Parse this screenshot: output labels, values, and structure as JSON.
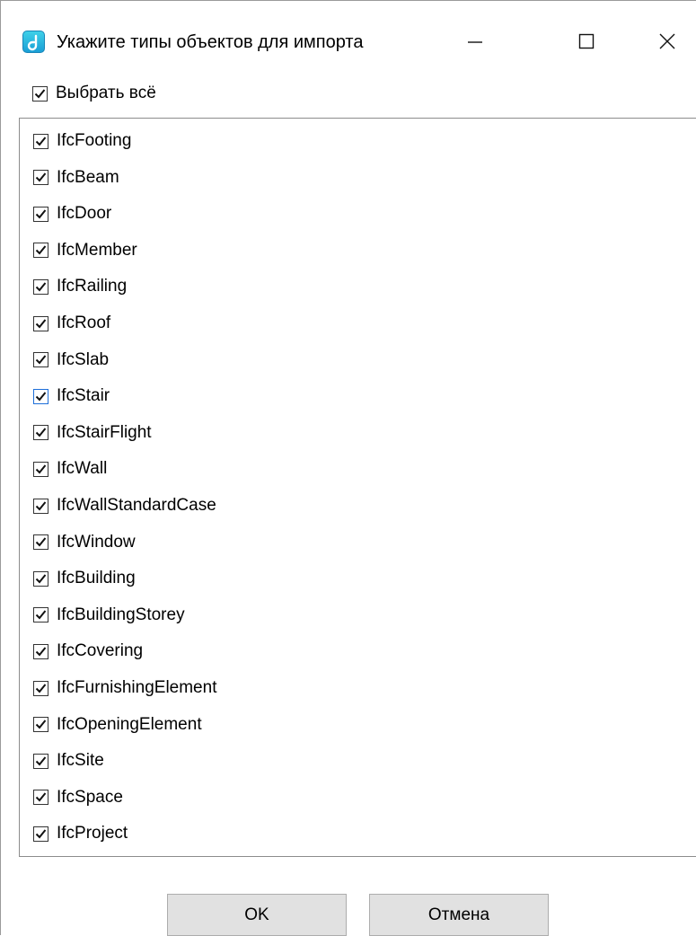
{
  "window": {
    "title": "Укажите типы объектов для импорта",
    "icon": "app-logo-icon",
    "controls": [
      "minimize-icon",
      "maximize-icon",
      "close-icon"
    ]
  },
  "select_all": {
    "label": "Выбрать всё",
    "checked": true
  },
  "items": [
    {
      "label": "IfcFooting",
      "checked": true
    },
    {
      "label": "IfcBeam",
      "checked": true
    },
    {
      "label": "IfcDoor",
      "checked": true
    },
    {
      "label": "IfcMember",
      "checked": true
    },
    {
      "label": "IfcRailing",
      "checked": true
    },
    {
      "label": "IfcRoof",
      "checked": true
    },
    {
      "label": "IfcSlab",
      "checked": true
    },
    {
      "label": "IfcStair",
      "checked": true,
      "focused": true
    },
    {
      "label": "IfcStairFlight",
      "checked": true
    },
    {
      "label": "IfcWall",
      "checked": true
    },
    {
      "label": "IfcWallStandardCase",
      "checked": true
    },
    {
      "label": "IfcWindow",
      "checked": true
    },
    {
      "label": "IfcBuilding",
      "checked": true
    },
    {
      "label": "IfcBuildingStorey",
      "checked": true
    },
    {
      "label": "IfcCovering",
      "checked": true
    },
    {
      "label": "IfcFurnishingElement",
      "checked": true
    },
    {
      "label": "IfcOpeningElement",
      "checked": true
    },
    {
      "label": "IfcSite",
      "checked": true
    },
    {
      "label": "IfcSpace",
      "checked": true
    },
    {
      "label": "IfcProject",
      "checked": true
    }
  ],
  "buttons": {
    "ok": "OK",
    "cancel": "Отмена"
  },
  "colors": {
    "focus_border": "#1e6fd9",
    "button_bg": "#e1e1e1",
    "icon_accent": "#1a9fd6"
  }
}
